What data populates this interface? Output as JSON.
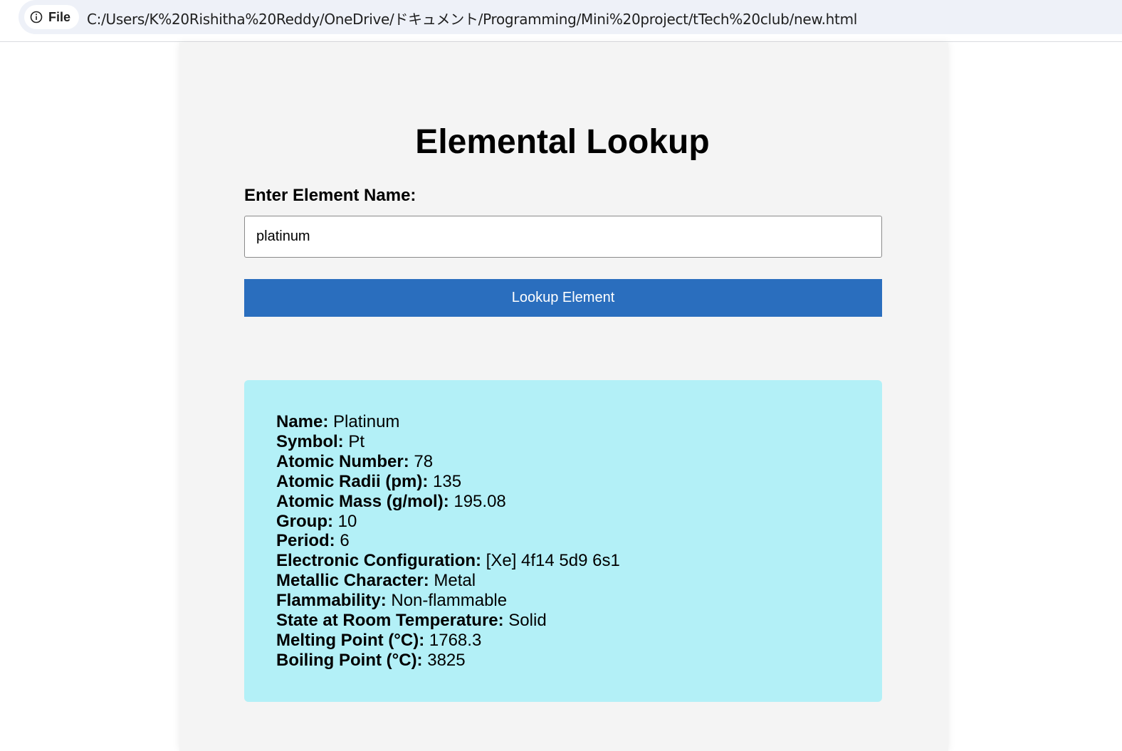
{
  "browser": {
    "chip_label": "File",
    "url": "C:/Users/K%20Rishitha%20Reddy/OneDrive/ドキュメント/Programming/Mini%20project/tTech%20club/new.html"
  },
  "page": {
    "title": "Elemental Lookup",
    "input_label": "Enter Element Name:",
    "input_value": "platinum",
    "button_label": "Lookup Element"
  },
  "colors": {
    "button_bg": "#2a6ebe",
    "result_bg": "#b3f0f7",
    "card_bg": "#f4f4f4"
  },
  "result": {
    "rows": [
      {
        "label": "Name:",
        "value": "Platinum"
      },
      {
        "label": "Symbol:",
        "value": "Pt"
      },
      {
        "label": "Atomic Number:",
        "value": "78"
      },
      {
        "label": "Atomic Radii (pm):",
        "value": "135"
      },
      {
        "label": "Atomic Mass (g/mol):",
        "value": "195.08"
      },
      {
        "label": "Group:",
        "value": "10"
      },
      {
        "label": "Period:",
        "value": "6"
      },
      {
        "label": "Electronic Configuration:",
        "value": "[Xe] 4f14 5d9 6s1"
      },
      {
        "label": "Metallic Character:",
        "value": "Metal"
      },
      {
        "label": "Flammability:",
        "value": "Non-flammable"
      },
      {
        "label": "State at Room Temperature:",
        "value": "Solid"
      },
      {
        "label": "Melting Point (°C):",
        "value": "1768.3"
      },
      {
        "label": "Boiling Point (°C):",
        "value": "3825"
      }
    ]
  }
}
